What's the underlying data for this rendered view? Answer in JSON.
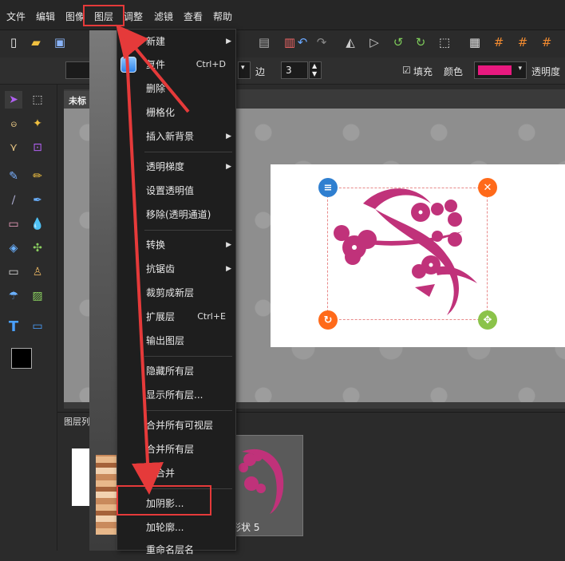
{
  "menubar": {
    "items": [
      {
        "label": "文件"
      },
      {
        "label": "编辑"
      },
      {
        "label": "图像"
      },
      {
        "label": "图层"
      },
      {
        "label": "调整"
      },
      {
        "label": "滤镜"
      },
      {
        "label": "查看"
      },
      {
        "label": "帮助"
      }
    ]
  },
  "options": {
    "edge_label": "边",
    "edge_value": "3",
    "fill_label": "填充",
    "color_label": "颜色",
    "color_value": "#e8197f",
    "opacity_label": "透明度"
  },
  "document": {
    "tab_title": "未标"
  },
  "layer_panel": {
    "title": "图层列",
    "shape_label": "形状 5"
  },
  "dropdown": {
    "items": [
      {
        "label": "新建",
        "has_submenu": true
      },
      {
        "label": "复件",
        "shortcut": "Ctrl+D"
      },
      {
        "label": "删除"
      },
      {
        "label": "栅格化"
      },
      {
        "label": "插入新背景",
        "has_submenu": true
      },
      {
        "label": "透明梯度",
        "has_submenu": true
      },
      {
        "label": "设置透明值"
      },
      {
        "label": "移除(透明通道)"
      },
      {
        "label": "转换",
        "has_submenu": true
      },
      {
        "label": "抗锯齿",
        "has_submenu": true
      },
      {
        "label": "裁剪成新层"
      },
      {
        "label": "扩展层",
        "shortcut": "Ctrl+E"
      },
      {
        "label": "输出图层"
      },
      {
        "label": "隐藏所有层"
      },
      {
        "label": "显示所有层..."
      },
      {
        "label": "合并所有可视层"
      },
      {
        "label": "合并所有层"
      },
      {
        "label": "缝合并"
      },
      {
        "label": "加阴影..."
      },
      {
        "label": "加轮廓..."
      },
      {
        "label": "重命名层名"
      }
    ]
  },
  "colors": {
    "accent_red": "#e53a3a",
    "flower_magenta": "#c0327a",
    "handle_blue": "#2f7fd0",
    "handle_orange": "#ff6a1a",
    "handle_green": "#8bc34a"
  }
}
